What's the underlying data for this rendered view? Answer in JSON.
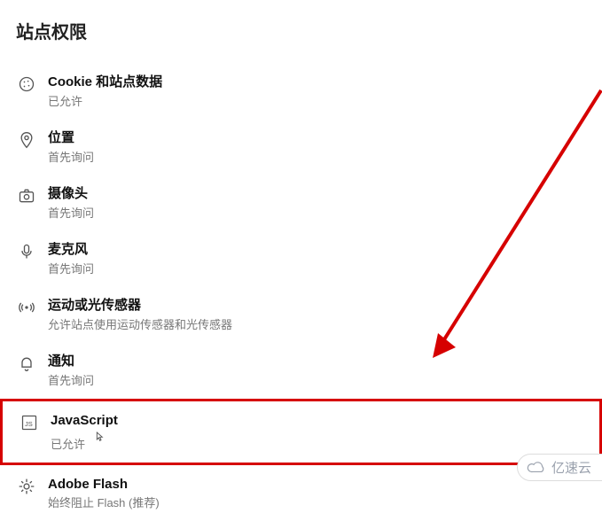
{
  "title": "站点权限",
  "items": [
    {
      "label": "Cookie 和站点数据",
      "status": "已允许"
    },
    {
      "label": "位置",
      "status": "首先询问"
    },
    {
      "label": "摄像头",
      "status": "首先询问"
    },
    {
      "label": "麦克风",
      "status": "首先询问"
    },
    {
      "label": "运动或光传感器",
      "status": "允许站点使用运动传感器和光传感器"
    },
    {
      "label": "通知",
      "status": "首先询问"
    },
    {
      "label": "JavaScript",
      "status": "已允许"
    },
    {
      "label": "Adobe Flash",
      "status": "始终阻止 Flash (推荐)"
    }
  ],
  "watermark": "亿速云"
}
